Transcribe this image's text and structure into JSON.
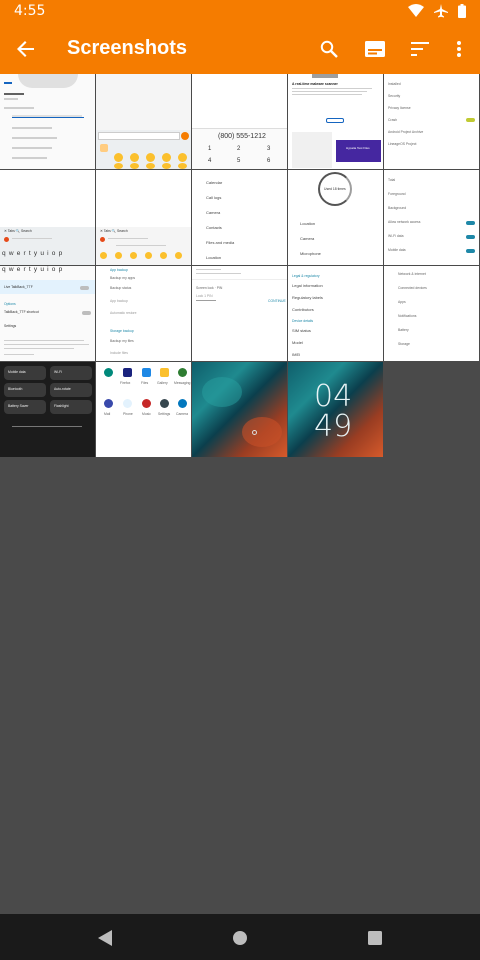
{
  "status_bar": {
    "time": "4:55"
  },
  "app_bar": {
    "title": "Screenshots"
  },
  "icons": {
    "back": "arrow-left",
    "search": "magnifier",
    "slideshow": "slideshow",
    "sort": "sort-lines",
    "more": "vertical-dots"
  },
  "colors": {
    "accent": "#f57c00",
    "background": "#4a4a4a",
    "nav_bar": "#1a1a1a"
  },
  "thumbs": {
    "t4": {
      "title": "A real-time malware scanner",
      "badge": "Hypatia Test Files"
    },
    "t3": {
      "number": "(800) 555-1212"
    },
    "t5": {
      "items": [
        "Installed",
        "Security",
        "Privacy license",
        "Crash",
        "Android Project Archive",
        "LineageOS Project"
      ]
    },
    "t8": {
      "items": [
        "Calendar",
        "Call logs",
        "Camera",
        "Contacts",
        "Files and media",
        "Location"
      ]
    },
    "t9": {
      "items": [
        "Location",
        "Camera",
        "Microphone"
      ],
      "center": "Used 18 times"
    },
    "t10": {
      "items": [
        "Total",
        "Foreground",
        "Background",
        "Allow network access",
        "Wi-Fi data",
        "Mobile data"
      ]
    },
    "t11": {
      "label": "Live TalkBack_TTF",
      "row": "TalkBack_TTF shortcut",
      "section": "Settings"
    },
    "t14": {
      "items": [
        "Legal information",
        "Regulatory labels",
        "Contributors",
        "SIM status",
        "Model",
        "IMEI"
      ]
    },
    "t15": {
      "items": [
        "Network & internet",
        "Connected devices",
        "Apps",
        "Notifications",
        "Battery",
        "Storage"
      ]
    },
    "t16": {
      "tiles": [
        "Mobile data",
        "Wi-Fi",
        "Bluetooth",
        "Auto-rotate",
        "Battery Saver",
        "Flashlight"
      ]
    },
    "t17": {
      "apps": [
        "Firefox",
        "Files",
        "Gallery",
        "Messaging",
        "Mail",
        "Phone",
        "Music",
        "Settings",
        "Camera"
      ]
    },
    "t20": {
      "clock": "04\n49"
    }
  }
}
